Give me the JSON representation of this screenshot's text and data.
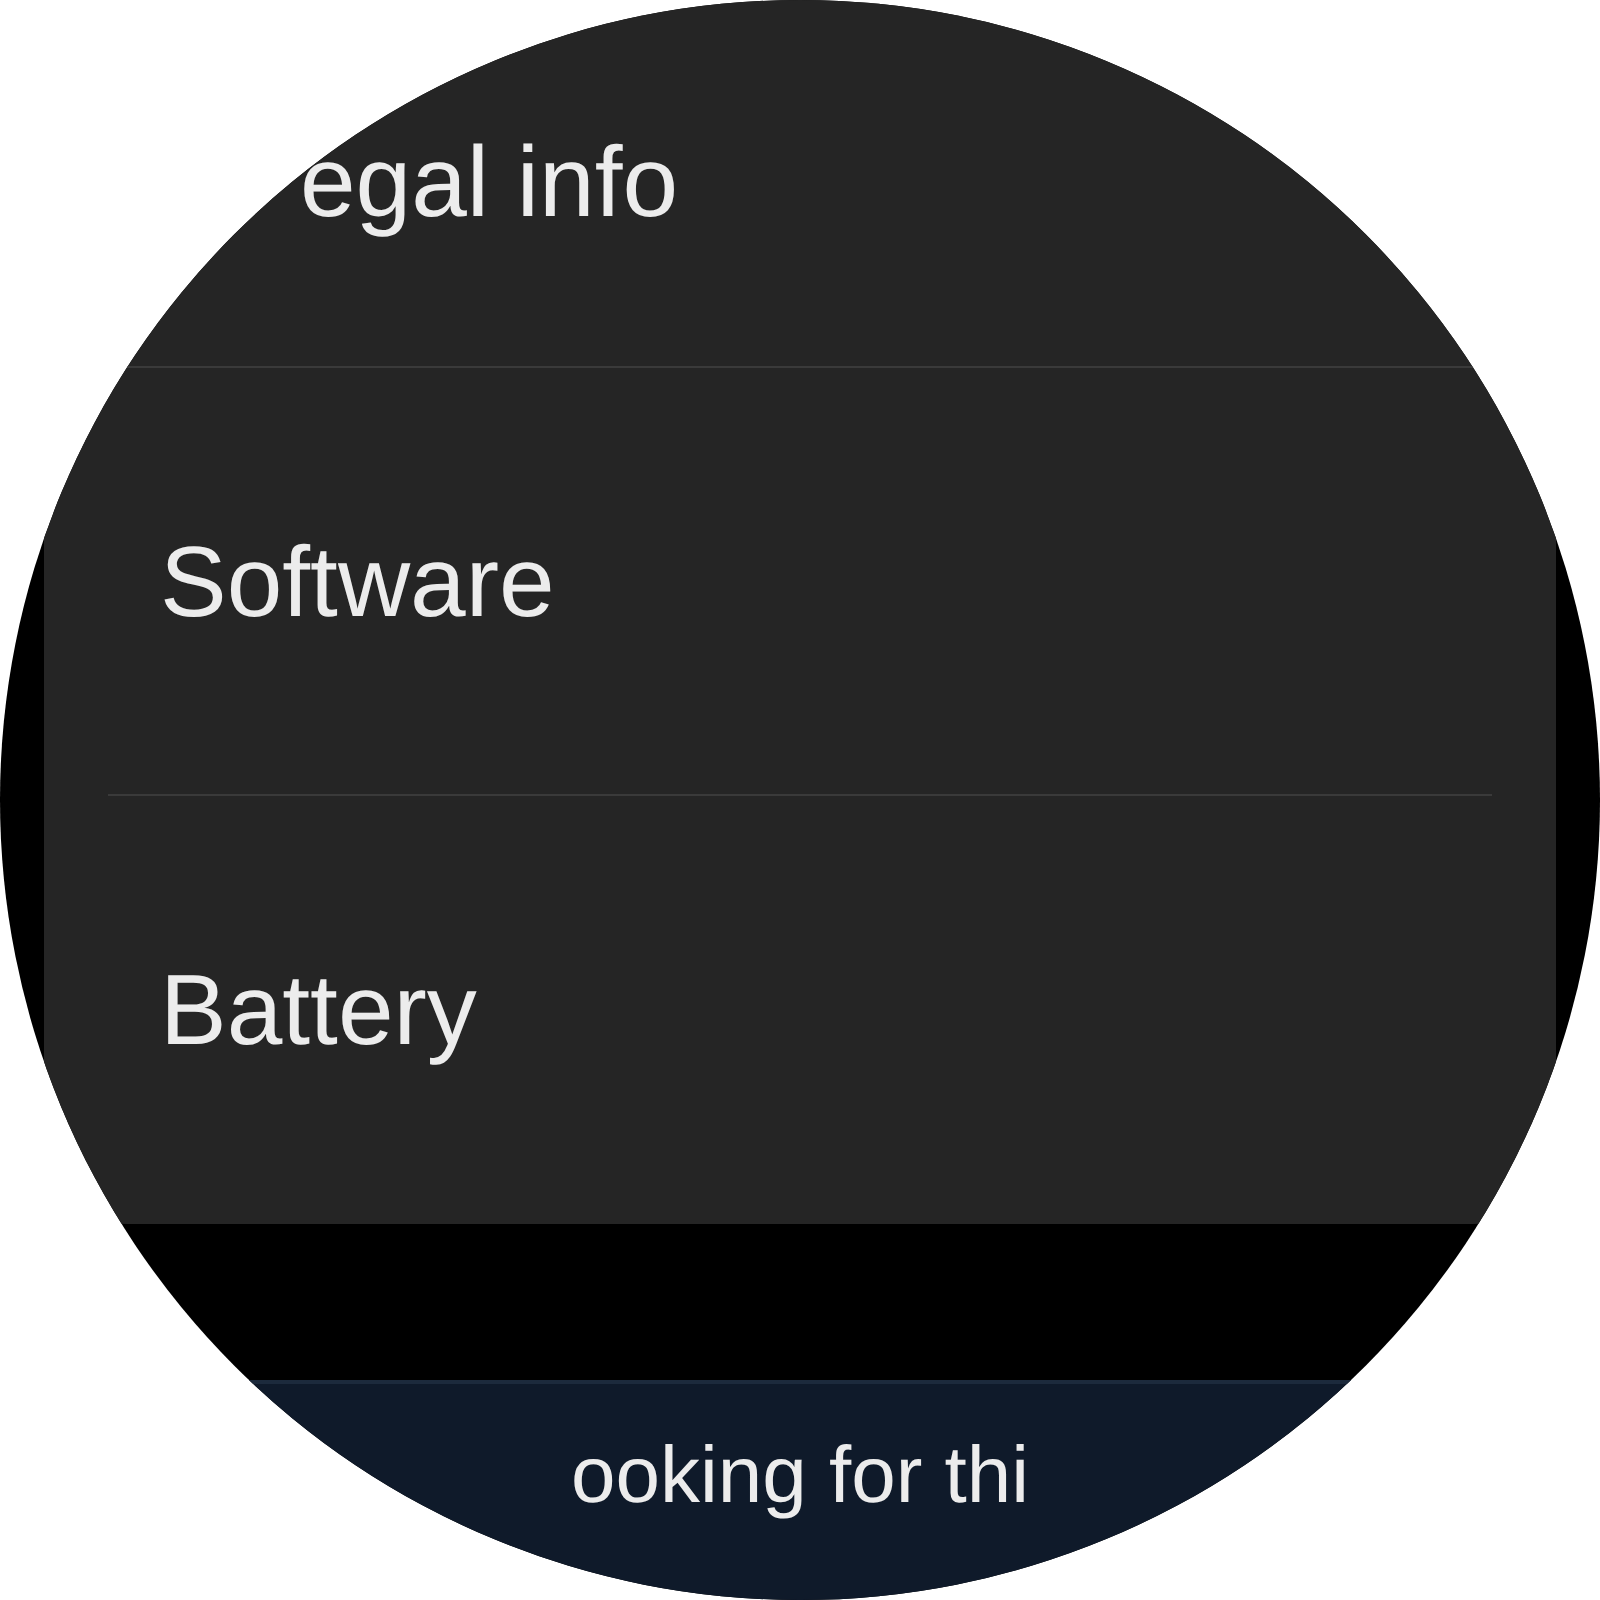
{
  "menu_items": [
    {
      "label": "egal info"
    },
    {
      "label": "Software"
    },
    {
      "label": "Battery"
    }
  ],
  "suggestion": {
    "title": "ooking for thi"
  }
}
